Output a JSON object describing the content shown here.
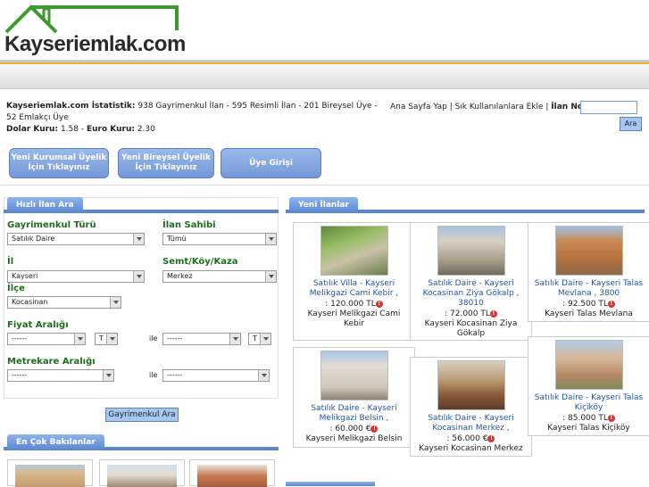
{
  "header": {
    "logo_text": "Kayseriemlak.com"
  },
  "stats": {
    "line1_bold": "Kayseriemlak.com İstatistik:",
    "line1_rest": "938 Gayrimenkul İlan - 595 Resimli İlan - 201 Bireysel Üye - 52 Emlakçı Üye",
    "dolar_label": "Dolar Kuru:",
    "dolar_value": "1.58",
    "euro_label": "Euro Kuru:",
    "euro_value": "2.30"
  },
  "toplinks": {
    "home": "Ana Sayfa Yap",
    "fav": "Sık Kullanılanlara Ekle",
    "ilan_no": "İlan No:",
    "ara": "Ara"
  },
  "register": {
    "kurumsal": "Yeni Kurumsal Üyelik İçin Tıklayınız",
    "bireysel": "Yeni Bireysel Üyelik İçin Tıklayınız",
    "giris": "Üye Girişi"
  },
  "search_panel": {
    "title": "Hızlı İlan Ara",
    "gayrimenkul_label": "Gayrimenkul Türü",
    "gayrimenkul_value": "Satılık Daire",
    "sahibi_label": "İlan Sahibi",
    "sahibi_value": "Tümü",
    "il_label": "İl",
    "il_value": "Kayseri",
    "semt_label": "Semt/Köy/Kaza",
    "semt_value": "Merkez",
    "ilce_label": "İlçe",
    "ilce_value": "Kocasinan",
    "fiyat_label": "Fiyat Aralığı",
    "fiyat_min": "------",
    "fiyat_min_cur": "T",
    "ile": "ile",
    "fiyat_max": "------",
    "fiyat_max_cur": "T",
    "metrekare_label": "Metrekare Aralığı",
    "m2_min": "------",
    "m2_max": "------",
    "button": "Gayrimenkul Ara"
  },
  "most_viewed": {
    "title": "En Çok Bakılanlar"
  },
  "new_listings": {
    "title": "Yeni İlanlar",
    "items": [
      {
        "title": "Satılık Villa - Kayseri Melikgazi Cami Kebir ,",
        "price": ": 120.000 TL",
        "loc": "Kayseri Melikgazi Cami Kebir"
      },
      {
        "title": "Satılık Daire - Kayseri Kocasinan Ziya Gökalp , 38010",
        "price": ": 72.000 TL",
        "loc": "Kayseri Kocasinan Ziya Gökalp"
      },
      {
        "title": "Satılık Daire - Kayseri Talas Mevlana , 3800",
        "price": ": 92.500 TL",
        "loc": "Kayseri Talas Mevlana"
      },
      {
        "title": "Satılık Daire - Kayseri Melikgazi Belsin ,",
        "price": ": 60.000 €",
        "loc": "Kayseri Melikgazi Belsin"
      },
      {
        "title": "Satılık Daire - Kayseri Kocasinan Merkez ,",
        "price": ": 56.000 €",
        "loc": "Kayseri Kocasinan Merkez"
      },
      {
        "title": "Satılık Daire - Kayseri Talas Kiçiköy",
        "price": ": 85.000 TL",
        "loc": "Kayseri Talas Kiçiköy"
      }
    ]
  },
  "colors": {
    "accent": "#5a86d0",
    "label_green": "#1e6e1e",
    "link_blue": "#2255aa",
    "logo_green": "#3e9a2e",
    "header_gold": "#e8b631"
  }
}
